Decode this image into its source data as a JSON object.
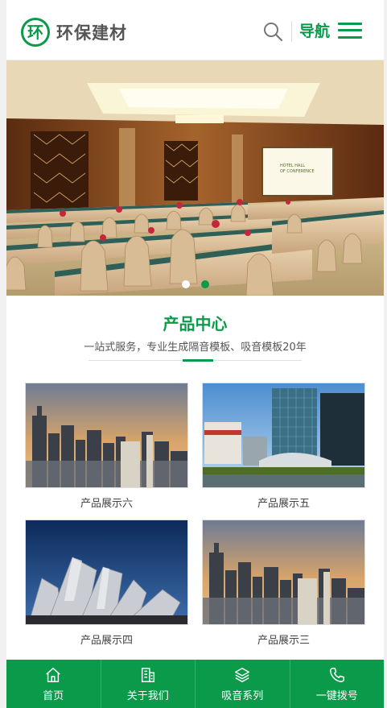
{
  "header": {
    "logo_mark": "环",
    "logo_text": "环保建材",
    "nav_label": "导航"
  },
  "banner": {
    "screen_text": "HOTEL HALL OF CONFERENCE",
    "slide_count": 2,
    "active_slide": 2
  },
  "section": {
    "title": "产品中心",
    "subtitle": "一站式服务，专业生成隔音模板、吸音模板20年"
  },
  "products": [
    {
      "caption": "产品展示六",
      "image": "city-skyline-sunset"
    },
    {
      "caption": "产品展示五",
      "image": "glass-towers-waterfront"
    },
    {
      "caption": "产品展示四",
      "image": "metal-concert-hall"
    },
    {
      "caption": "产品展示三",
      "image": "city-skyline-sunset"
    }
  ],
  "footer": {
    "items": [
      {
        "label": "首页",
        "icon": "home-icon"
      },
      {
        "label": "关于我们",
        "icon": "building-icon"
      },
      {
        "label": "吸音系列",
        "icon": "layers-icon"
      },
      {
        "label": "一键拨号",
        "icon": "phone-icon"
      }
    ]
  },
  "colors": {
    "accent": "#0b9a4a",
    "text": "#333333",
    "subtle": "#555555"
  }
}
